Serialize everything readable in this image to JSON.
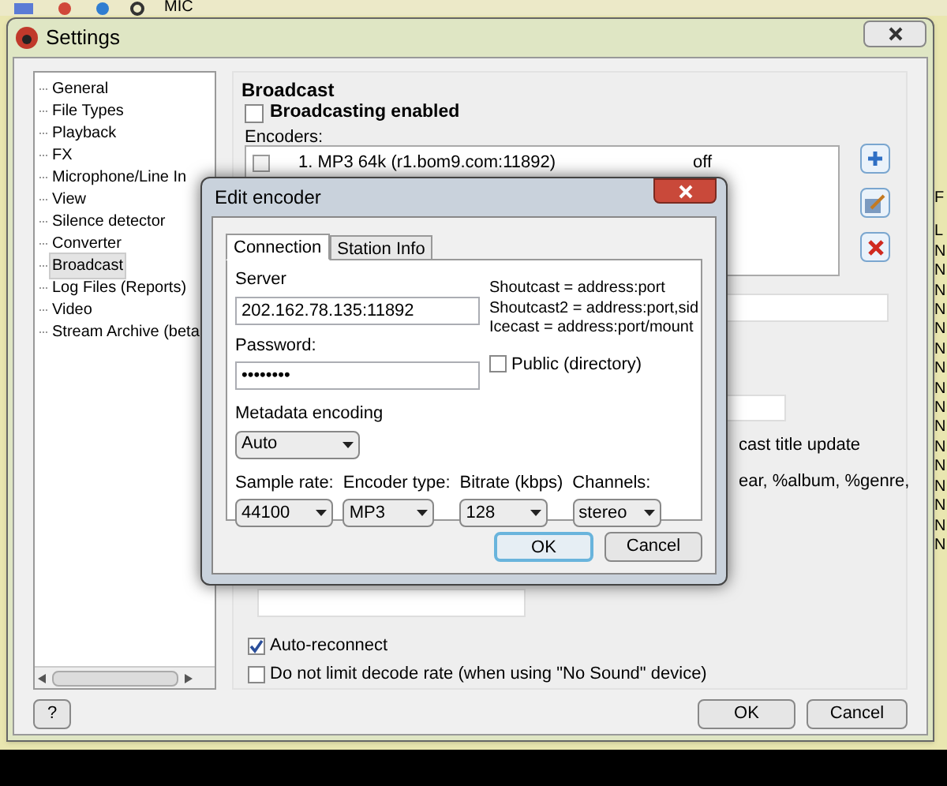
{
  "taskbar": {
    "label": "MIC"
  },
  "window": {
    "title": "Settings"
  },
  "sidebar": {
    "items": [
      {
        "label": "General",
        "selected": false
      },
      {
        "label": "File Types",
        "selected": false
      },
      {
        "label": "Playback",
        "selected": false
      },
      {
        "label": "FX",
        "selected": false
      },
      {
        "label": "Microphone/Line In",
        "selected": false
      },
      {
        "label": "View",
        "selected": false
      },
      {
        "label": "Silence detector",
        "selected": false
      },
      {
        "label": "Converter",
        "selected": false
      },
      {
        "label": "Broadcast",
        "selected": true
      },
      {
        "label": "Log Files (Reports)",
        "selected": false
      },
      {
        "label": "Video",
        "selected": false
      },
      {
        "label": "Stream Archive (beta",
        "selected": false
      }
    ]
  },
  "broadcast": {
    "title": "Broadcast",
    "enabled": {
      "label": "Broadcasting enabled",
      "checked": false
    },
    "encoders_label": "Encoders:",
    "encoders": [
      {
        "name": "1. MP3 64k (r1.bom9.com:11892)",
        "status": "off",
        "checked": false
      }
    ],
    "title_update_fragment": "cast title update",
    "tags_fragment": "ear, %album, %genre,",
    "auto_reconnect": {
      "label": "Auto-reconnect",
      "checked": true
    },
    "no_limit": {
      "label": "Do not limit decode rate (when using \"No Sound\" device)",
      "checked": false
    }
  },
  "background_list": {
    "header": "F",
    "items": [
      "L",
      "N",
      "N",
      "N",
      "N",
      "N",
      "N",
      "N",
      "N",
      "N",
      "N",
      "N",
      "N",
      "N",
      "N",
      "N",
      "N"
    ]
  },
  "buttons": {
    "help": "?",
    "ok": "OK",
    "cancel": "Cancel"
  },
  "dialog": {
    "title": "Edit encoder",
    "tabs": [
      {
        "label": "Connection",
        "selected": true
      },
      {
        "label": "Station Info",
        "selected": false
      }
    ],
    "server_label": "Server",
    "server": "202.162.78.135:11892",
    "hints": [
      "Shoutcast = address:port",
      "Shoutcast2 = address:port,sid",
      "Icecast = address:port/mount"
    ],
    "password_label": "Password:",
    "password": "••••••••",
    "public": {
      "label": "Public (directory)",
      "checked": false
    },
    "metadata_label": "Metadata encoding",
    "metadata": "Auto",
    "selects": [
      {
        "label": "Sample rate:",
        "value": "44100"
      },
      {
        "label": "Encoder type:",
        "value": "MP3"
      },
      {
        "label": "Bitrate (kbps)",
        "value": "128"
      },
      {
        "label": "Channels:",
        "value": "stereo"
      }
    ],
    "ok": "OK",
    "cancel": "Cancel"
  }
}
